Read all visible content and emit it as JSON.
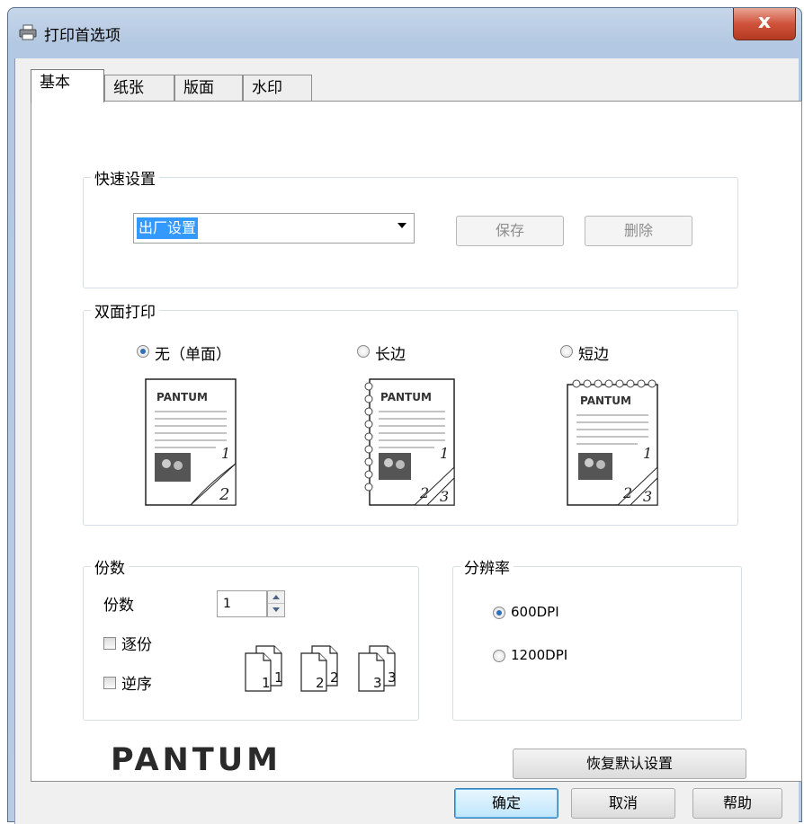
{
  "window": {
    "title": "打印首选项",
    "close_glyph": "x"
  },
  "tabs": [
    {
      "label": "基本",
      "active": true
    },
    {
      "label": "纸张",
      "active": false
    },
    {
      "label": "版面",
      "active": false
    },
    {
      "label": "水印",
      "active": false
    }
  ],
  "quick_settings": {
    "title": "快速设置",
    "selected": "出厂设置",
    "save_label": "保存",
    "delete_label": "删除"
  },
  "duplex": {
    "title": "双面打印",
    "options": [
      {
        "label": "无（单面）",
        "selected": true
      },
      {
        "label": "长边",
        "selected": false
      },
      {
        "label": "短边",
        "selected": false
      }
    ],
    "preview_brand": "PANTUM"
  },
  "copies": {
    "title": "份数",
    "label": "份数",
    "value": "1",
    "collate_label": "逐份",
    "collate_checked": false,
    "reverse_label": "逆序",
    "reverse_checked": false,
    "page_numbers": [
      "1",
      "2",
      "3"
    ]
  },
  "resolution": {
    "title": "分辨率",
    "options": [
      {
        "label": "600DPI",
        "selected": true
      },
      {
        "label": "1200DPI",
        "selected": false
      }
    ]
  },
  "logo_text": "PANTUM",
  "restore_defaults_label": "恢复默认设置",
  "footer": {
    "ok_label": "确定",
    "cancel_label": "取消",
    "help_label": "帮助"
  },
  "colors": {
    "selection": "#3399ff",
    "title_bar": "#b8cbe3",
    "close_button": "#d0533b"
  }
}
